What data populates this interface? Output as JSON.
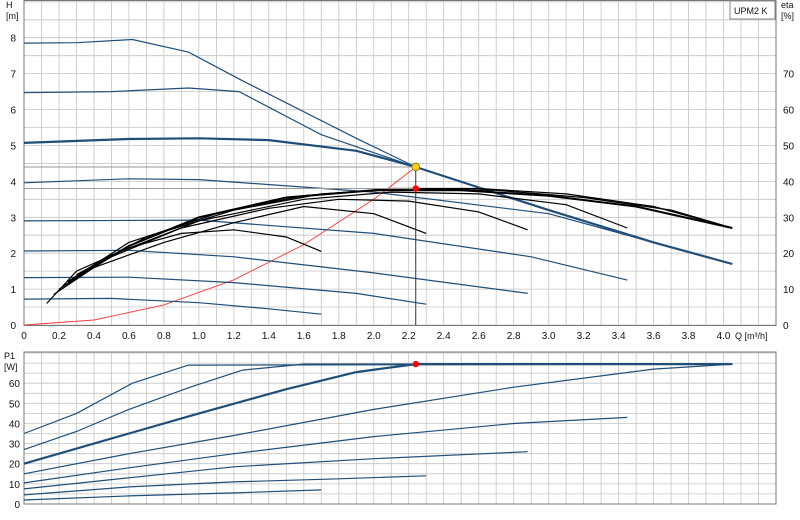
{
  "chart_data": [
    {
      "type": "line",
      "title": "UPM2 K",
      "ylabel": "H\n[m]",
      "y2label": "eta\n[%]",
      "xlabel": "Q [m³/h]",
      "xlim": [
        0,
        4.3
      ],
      "ylim": [
        0,
        9.05
      ],
      "y2lim": [
        0,
        90.5
      ],
      "grid": true,
      "xticks": [
        "0",
        "0.2",
        "0.4",
        "0.6",
        "0.8",
        "1.0",
        "1.2",
        "1.4",
        "1.6",
        "1.8",
        "2.0",
        "2.2",
        "2.4",
        "2.6",
        "2.8",
        "3.0",
        "3.2",
        "3.4",
        "3.6",
        "3.8",
        "4.0"
      ],
      "yticks": [
        "0",
        "1",
        "2",
        "3",
        "4",
        "5",
        "6",
        "7",
        "8"
      ],
      "y2ticks": [
        "0",
        "10",
        "20",
        "30",
        "40",
        "50",
        "60",
        "70"
      ],
      "colors": {
        "curve": "#1f4e79",
        "eta": "#000000",
        "system": "#ff3b3b",
        "point": "#ff0000",
        "duty": "#ffd21a"
      },
      "curves": [
        {
          "width": 1.2,
          "x": [
            0,
            0.3,
            0.62,
            0.94,
            1.25,
            1.9,
            2.24
          ],
          "y": [
            7.85,
            7.86,
            7.95,
            7.6,
            6.8,
            5.2,
            4.4
          ]
        },
        {
          "width": 1.2,
          "x": [
            0,
            0.5,
            0.94,
            1.23,
            1.7,
            2.24
          ],
          "y": [
            6.47,
            6.5,
            6.6,
            6.5,
            5.3,
            4.4
          ]
        },
        {
          "width": 2.2,
          "x": [
            0,
            0.6,
            1.0,
            1.4,
            1.9,
            2.24,
            3.0,
            3.6,
            4.05
          ],
          "y": [
            5.07,
            5.18,
            5.2,
            5.15,
            4.85,
            4.4,
            3.2,
            2.3,
            1.7
          ]
        },
        {
          "width": 1.2,
          "x": [
            0,
            0.6,
            1.0,
            2.0,
            3.0,
            3.6,
            4.05
          ],
          "y": [
            3.96,
            4.07,
            4.05,
            3.7,
            3.1,
            2.3,
            1.7
          ]
        },
        {
          "width": 1.2,
          "x": [
            0,
            1.0,
            2.0,
            2.9,
            3.45
          ],
          "y": [
            2.9,
            2.92,
            2.55,
            1.9,
            1.25
          ]
        },
        {
          "width": 1.2,
          "x": [
            0,
            0.6,
            1.2,
            2.0,
            2.88
          ],
          "y": [
            2.06,
            2.08,
            1.9,
            1.45,
            0.88
          ]
        },
        {
          "width": 1.2,
          "x": [
            0,
            0.6,
            1.2,
            1.9,
            2.3
          ],
          "y": [
            1.32,
            1.33,
            1.18,
            0.88,
            0.58
          ]
        },
        {
          "width": 1.2,
          "x": [
            0,
            0.5,
            1.0,
            1.4,
            1.7
          ],
          "y": [
            0.72,
            0.74,
            0.62,
            0.45,
            0.3
          ]
        }
      ],
      "eta_curves": [
        {
          "width": 1.2,
          "x": [
            0.13,
            0.3,
            0.6,
            0.9,
            1.2,
            1.5,
            1.7
          ],
          "y": [
            6,
            15,
            21.5,
            25.5,
            26.5,
            24.5,
            20.5
          ]
        },
        {
          "width": 1.2,
          "x": [
            0.17,
            0.4,
            0.8,
            1.2,
            1.6,
            2.0,
            2.3
          ],
          "y": [
            8.5,
            16,
            23,
            28.5,
            33,
            31,
            25.5
          ]
        },
        {
          "width": 1.2,
          "x": [
            0.2,
            0.5,
            0.9,
            1.4,
            1.8,
            2.2,
            2.6,
            2.88
          ],
          "y": [
            10,
            19,
            27,
            32.5,
            35,
            34.5,
            31.5,
            26.5
          ]
        },
        {
          "width": 1.2,
          "x": [
            0.23,
            0.5,
            1.0,
            1.6,
            2.1,
            2.6,
            3.1,
            3.45
          ],
          "y": [
            11,
            19.5,
            29,
            35,
            37,
            36.5,
            33.5,
            27
          ]
        },
        {
          "width": 2.0,
          "x": [
            0.25,
            0.6,
            1.0,
            1.5,
            2.0,
            2.5,
            3.0,
            3.5,
            4.05
          ],
          "y": [
            12,
            22,
            30,
            35.5,
            37.5,
            37.5,
            36,
            33,
            27
          ]
        },
        {
          "width": 1.2,
          "x": [
            0.28,
            0.6,
            1.1,
            1.6,
            2.1,
            2.6,
            3.1,
            3.6,
            4.05
          ],
          "y": [
            13,
            23,
            31,
            36,
            38,
            38,
            36.5,
            33,
            27
          ]
        },
        {
          "width": 1.2,
          "x": [
            0.3,
            0.7,
            1.2,
            1.7,
            2.2,
            2.7,
            3.2,
            3.7,
            4.05
          ],
          "y": [
            14,
            24.5,
            32,
            36.5,
            38,
            37.5,
            35.5,
            32,
            27
          ]
        }
      ],
      "system_curve": {
        "x": [
          0,
          0.4,
          0.8,
          1.2,
          1.6,
          2.0,
          2.24
        ],
        "y": [
          0,
          0.14,
          0.56,
          1.26,
          2.24,
          3.5,
          4.4
        ]
      },
      "duty_point": {
        "x": 2.24,
        "y": 4.4
      },
      "eta_point": {
        "x": 2.24,
        "y": 3.8
      },
      "duty_hline_y": 4.4,
      "eta_hline_y": 3.8
    },
    {
      "type": "line",
      "ylabel": "P1\n[W]",
      "xlim": [
        0,
        4.3
      ],
      "ylim": [
        0,
        75.5
      ],
      "yticks": [
        "0",
        "10",
        "20",
        "30",
        "40",
        "50",
        "60"
      ],
      "grid": true,
      "curves": [
        {
          "width": 1.2,
          "x": [
            0,
            0.3,
            0.62,
            0.94,
            4.05
          ],
          "y": [
            35,
            45,
            60,
            69,
            69.5
          ]
        },
        {
          "width": 1.2,
          "x": [
            0,
            0.3,
            0.6,
            0.95,
            1.25,
            1.6,
            4.05
          ],
          "y": [
            27,
            36,
            47,
            58,
            66.5,
            69.5,
            69.5
          ]
        },
        {
          "width": 2.2,
          "x": [
            0,
            0.6,
            1.0,
            1.5,
            1.9,
            2.24,
            4.05
          ],
          "y": [
            20,
            35,
            45,
            57,
            65.5,
            69.5,
            69.5
          ]
        },
        {
          "width": 1.2,
          "x": [
            0,
            0.6,
            1.2,
            2.0,
            2.8,
            3.6,
            4.05
          ],
          "y": [
            15,
            25,
            34,
            47,
            58,
            67,
            69.5
          ]
        },
        {
          "width": 1.2,
          "x": [
            0,
            0.6,
            1.2,
            2.0,
            2.8,
            3.45
          ],
          "y": [
            10.5,
            18,
            25,
            33.5,
            40,
            43
          ]
        },
        {
          "width": 1.2,
          "x": [
            0,
            0.6,
            1.2,
            2.0,
            2.88
          ],
          "y": [
            7.5,
            13,
            18.5,
            22.5,
            26
          ]
        },
        {
          "width": 1.2,
          "x": [
            0,
            0.6,
            1.2,
            1.8,
            2.3
          ],
          "y": [
            4.5,
            8.5,
            11,
            12.5,
            14
          ]
        },
        {
          "width": 1.2,
          "x": [
            0,
            0.6,
            1.2,
            1.7
          ],
          "y": [
            2,
            4,
            5.5,
            7
          ]
        }
      ],
      "duty_point": {
        "x": 2.24,
        "y": 69.5
      }
    }
  ]
}
